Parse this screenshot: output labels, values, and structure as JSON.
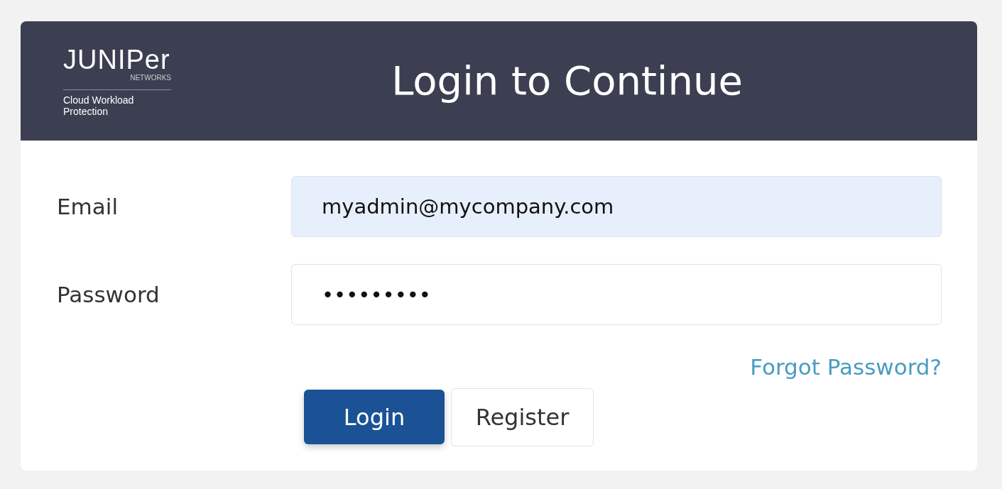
{
  "logo": {
    "wordmark": "JUNIPer",
    "subtitle": "NETWORKS",
    "product": "Cloud Workload Protection"
  },
  "title": "Login to Continue",
  "fields": [
    {
      "label": "Email",
      "value": "myadmin@mycompany.com",
      "autofilled": true
    },
    {
      "label": "Password",
      "value": "•••••••••",
      "autofilled": false
    }
  ],
  "forgot_link": "Forgot Password?",
  "buttons": [
    {
      "label": "Login",
      "kind": "primary"
    },
    {
      "label": "Register",
      "kind": "secondary"
    }
  ]
}
